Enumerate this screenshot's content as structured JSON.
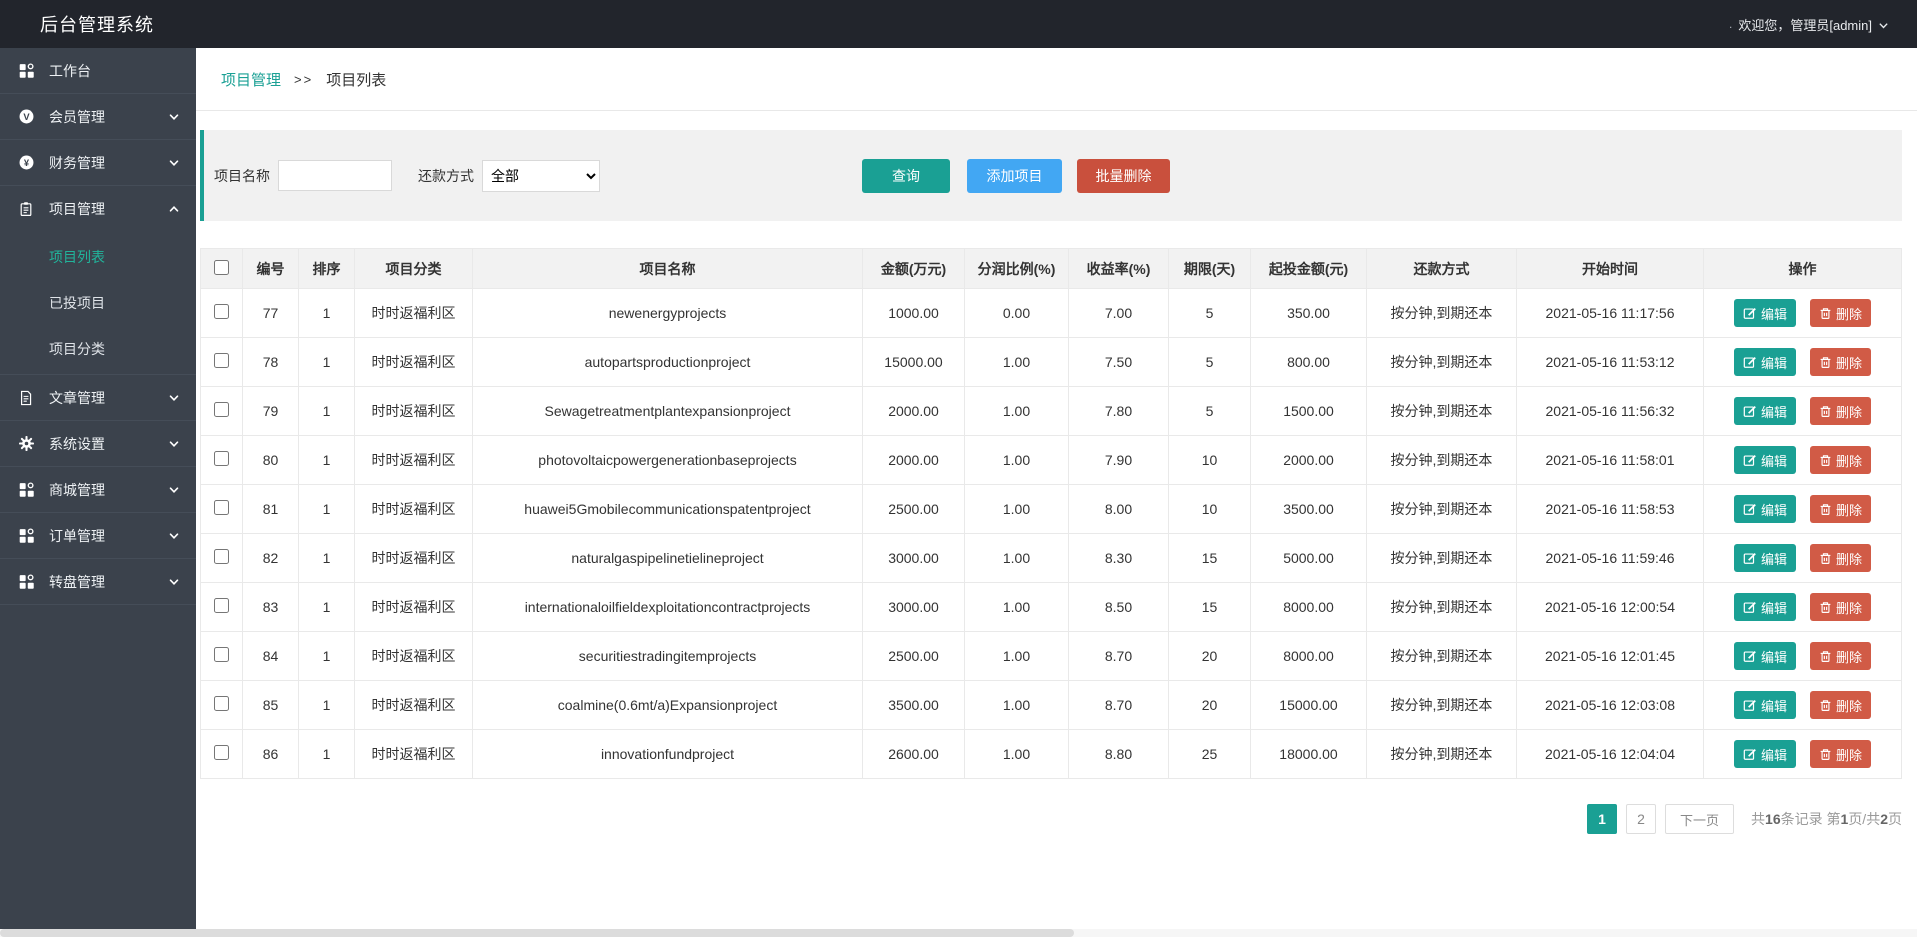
{
  "header": {
    "title": "后台管理系统",
    "dot": ".",
    "welcome": "欢迎您，管理员[admin]"
  },
  "sidebar": {
    "items": [
      {
        "label": "工作台",
        "icon": "grid-icon",
        "expandable": false
      },
      {
        "label": "会员管理",
        "icon": "member-circle-icon",
        "expandable": true
      },
      {
        "label": "财务管理",
        "icon": "yuan-circle-icon",
        "expandable": true
      },
      {
        "label": "项目管理",
        "icon": "clipboard-icon",
        "expandable": true,
        "expanded": true,
        "children": [
          {
            "label": "项目列表",
            "active": true
          },
          {
            "label": "已投项目",
            "active": false
          },
          {
            "label": "项目分类",
            "active": false
          }
        ]
      },
      {
        "label": "文章管理",
        "icon": "document-icon",
        "expandable": true
      },
      {
        "label": "系统设置",
        "icon": "gear-icon",
        "expandable": true
      },
      {
        "label": "商城管理",
        "icon": "grid-icon",
        "expandable": true
      },
      {
        "label": "订单管理",
        "icon": "grid-icon",
        "expandable": true
      },
      {
        "label": "转盘管理",
        "icon": "grid-icon",
        "expandable": true
      }
    ]
  },
  "breadcrumb": {
    "parent": "项目管理",
    "separator": ">>",
    "current": "项目列表"
  },
  "filters": {
    "name_label": "项目名称",
    "name_value": "",
    "repay_label": "还款方式",
    "repay_selected": "全部",
    "search_button": "查询",
    "add_button": "添加项目",
    "batch_delete_button": "批量删除"
  },
  "table": {
    "columns": [
      "编号",
      "排序",
      "项目分类",
      "项目名称",
      "金额(万元)",
      "分润比例(%)",
      "收益率(%)",
      "期限(天)",
      "起投金额(元)",
      "还款方式",
      "开始时间",
      "操作"
    ],
    "edit_label": "编辑",
    "delete_label": "删除",
    "rows": [
      {
        "id": "77",
        "sort": "1",
        "category": "时时返福利区",
        "name": "newenergyprojects",
        "amount": "1000.00",
        "ratio": "0.00",
        "rate": "7.00",
        "term": "5",
        "min_invest": "350.00",
        "repay": "按分钟,到期还本",
        "start_time": "2021-05-16 11:17:56"
      },
      {
        "id": "78",
        "sort": "1",
        "category": "时时返福利区",
        "name": "autopartsproductionproject",
        "amount": "15000.00",
        "ratio": "1.00",
        "rate": "7.50",
        "term": "5",
        "min_invest": "800.00",
        "repay": "按分钟,到期还本",
        "start_time": "2021-05-16 11:53:12"
      },
      {
        "id": "79",
        "sort": "1",
        "category": "时时返福利区",
        "name": "Sewagetreatmentplantexpansionproject",
        "amount": "2000.00",
        "ratio": "1.00",
        "rate": "7.80",
        "term": "5",
        "min_invest": "1500.00",
        "repay": "按分钟,到期还本",
        "start_time": "2021-05-16 11:56:32"
      },
      {
        "id": "80",
        "sort": "1",
        "category": "时时返福利区",
        "name": "photovoltaicpowergenerationbaseprojects",
        "amount": "2000.00",
        "ratio": "1.00",
        "rate": "7.90",
        "term": "10",
        "min_invest": "2000.00",
        "repay": "按分钟,到期还本",
        "start_time": "2021-05-16 11:58:01"
      },
      {
        "id": "81",
        "sort": "1",
        "category": "时时返福利区",
        "name": "huawei5Gmobilecommunicationspatentproject",
        "amount": "2500.00",
        "ratio": "1.00",
        "rate": "8.00",
        "term": "10",
        "min_invest": "3500.00",
        "repay": "按分钟,到期还本",
        "start_time": "2021-05-16 11:58:53"
      },
      {
        "id": "82",
        "sort": "1",
        "category": "时时返福利区",
        "name": "naturalgaspipelinetielineproject",
        "amount": "3000.00",
        "ratio": "1.00",
        "rate": "8.30",
        "term": "15",
        "min_invest": "5000.00",
        "repay": "按分钟,到期还本",
        "start_time": "2021-05-16 11:59:46"
      },
      {
        "id": "83",
        "sort": "1",
        "category": "时时返福利区",
        "name": "internationaloilfieldexploitationcontractprojects",
        "amount": "3000.00",
        "ratio": "1.00",
        "rate": "8.50",
        "term": "15",
        "min_invest": "8000.00",
        "repay": "按分钟,到期还本",
        "start_time": "2021-05-16 12:00:54"
      },
      {
        "id": "84",
        "sort": "1",
        "category": "时时返福利区",
        "name": "securitiestradingitemprojects",
        "amount": "2500.00",
        "ratio": "1.00",
        "rate": "8.70",
        "term": "20",
        "min_invest": "8000.00",
        "repay": "按分钟,到期还本",
        "start_time": "2021-05-16 12:01:45"
      },
      {
        "id": "85",
        "sort": "1",
        "category": "时时返福利区",
        "name": "coalmine(0.6mt/a)Expansionproject",
        "amount": "3500.00",
        "ratio": "1.00",
        "rate": "8.70",
        "term": "20",
        "min_invest": "15000.00",
        "repay": "按分钟,到期还本",
        "start_time": "2021-05-16 12:03:08"
      },
      {
        "id": "86",
        "sort": "1",
        "category": "时时返福利区",
        "name": "innovationfundproject",
        "amount": "2600.00",
        "ratio": "1.00",
        "rate": "8.80",
        "term": "25",
        "min_invest": "18000.00",
        "repay": "按分钟,到期还本",
        "start_time": "2021-05-16 12:04:04"
      }
    ]
  },
  "pagination": {
    "pages": [
      "1",
      "2"
    ],
    "active_page": "1",
    "next_label": "下一页",
    "summary_parts": [
      "共",
      "16",
      "条记录 第",
      "1",
      "页/共",
      "2",
      "页"
    ]
  },
  "colors": {
    "topbar_bg": "#22252c",
    "sidebar_bg": "#3b424c",
    "accent_teal": "#1aa094",
    "accent_blue": "#42a7f3",
    "accent_red": "#c9503d",
    "delete_red": "#d15b46",
    "active_menu_teal": "#21b49b",
    "table_header_bg": "#f2f2f2",
    "filter_bg": "#f1f1f1"
  }
}
